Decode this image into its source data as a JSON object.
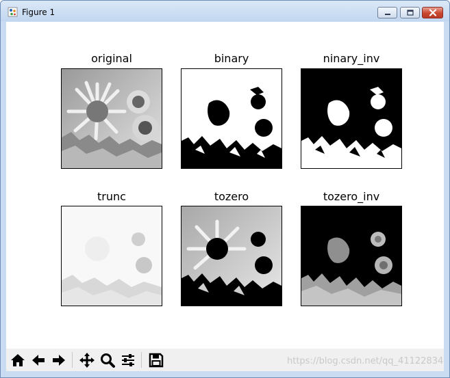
{
  "window": {
    "title": "Figure 1",
    "app_icon": "matplotlib-figure-icon",
    "controls": [
      "minimize",
      "maximize",
      "close"
    ]
  },
  "figure": {
    "subplots": [
      {
        "title": "original",
        "image": "grayscale sunflower photo"
      },
      {
        "title": "binary",
        "image": "binary threshold of sunflower photo"
      },
      {
        "title": "ninary_inv",
        "image": "inverted binary threshold of sunflower photo"
      },
      {
        "title": "trunc",
        "image": "truncated threshold of sunflower photo"
      },
      {
        "title": "tozero",
        "image": "to-zero threshold of sunflower photo"
      },
      {
        "title": "tozero_inv",
        "image": "inverted to-zero threshold of sunflower photo"
      }
    ]
  },
  "toolbar": {
    "buttons": [
      "home-icon",
      "back-icon",
      "forward-icon",
      "pan-icon",
      "zoom-icon",
      "subplots-icon",
      "save-icon"
    ]
  },
  "watermark": "https://blog.csdn.net/qq_41122834"
}
